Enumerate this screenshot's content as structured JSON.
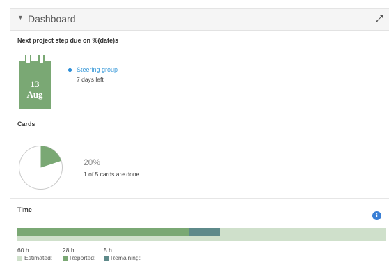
{
  "header": {
    "title": "Dashboard"
  },
  "next_step": {
    "title": "Next project step due on %(date)s",
    "calendar_day": "13",
    "calendar_month": "Aug",
    "milestone_name": "Steering group",
    "days_left": "7 days left"
  },
  "cards": {
    "title": "Cards",
    "percent": "20%",
    "done_fraction": 0.2,
    "summary": "1 of 5 cards are done."
  },
  "time": {
    "title": "Time",
    "estimated_value": "60 h",
    "reported_value": "28 h",
    "remaining_value": "5 h",
    "estimated_label": "Estimated",
    "reported_label": "Reported",
    "remaining_label": "Remaining",
    "estimated_hours": 60,
    "reported_hours": 28,
    "remaining_hours": 5
  },
  "colors": {
    "accent_green": "#7aa874",
    "remaining_teal": "#5e8a8a",
    "estimated_light": "#cfe0cb",
    "link_blue": "#3a9ad9",
    "info_blue": "#3a7fd5"
  }
}
